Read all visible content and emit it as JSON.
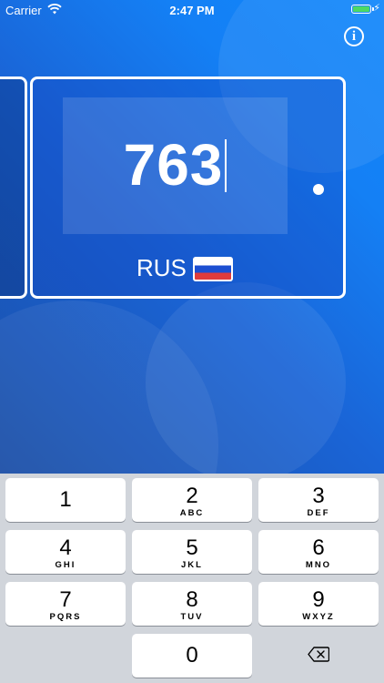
{
  "status": {
    "carrier": "Carrier",
    "time": "2:47 PM"
  },
  "info_icon": "info-icon",
  "plate": {
    "code": "763",
    "country": "RUS",
    "flag_colors": [
      "#ffffff",
      "#1c4fd1",
      "#e03b3b"
    ]
  },
  "keypad": {
    "keys": [
      {
        "num": "1",
        "letters": ""
      },
      {
        "num": "2",
        "letters": "ABC"
      },
      {
        "num": "3",
        "letters": "DEF"
      },
      {
        "num": "4",
        "letters": "GHI"
      },
      {
        "num": "5",
        "letters": "JKL"
      },
      {
        "num": "6",
        "letters": "MNO"
      },
      {
        "num": "7",
        "letters": "PQRS"
      },
      {
        "num": "8",
        "letters": "TUV"
      },
      {
        "num": "9",
        "letters": "WXYZ"
      },
      {
        "num": "0",
        "letters": ""
      }
    ],
    "delete_icon": "backspace-icon"
  },
  "colors": {
    "accent": "#1480f5",
    "keypad_bg": "#d1d5db"
  }
}
